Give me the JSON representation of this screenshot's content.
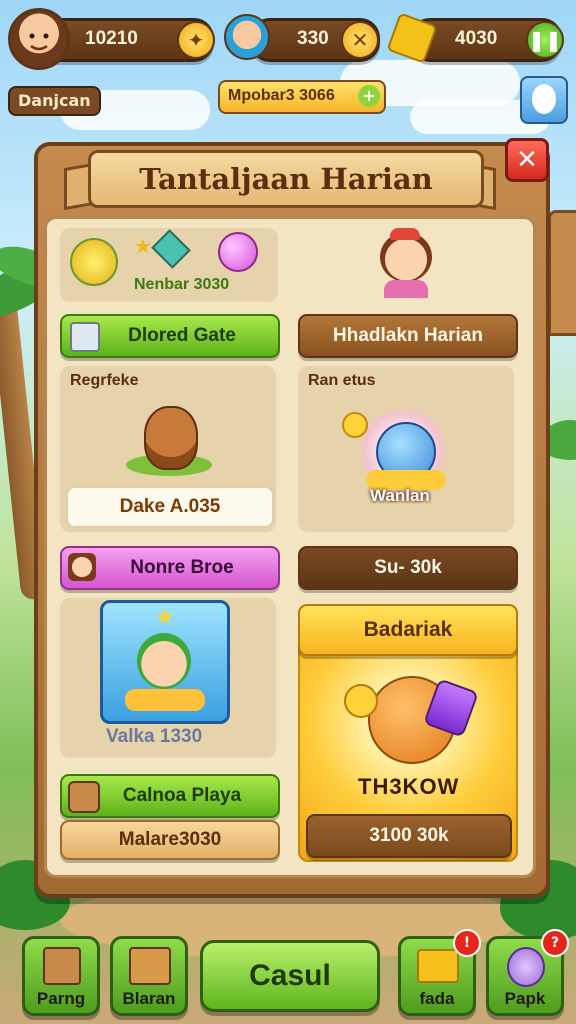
{
  "hud": {
    "coins": "10210",
    "gems": "330",
    "energy": "4030",
    "player_name": "Danjcan",
    "reward_banner": "Mpobar3 3066"
  },
  "panel": {
    "title": "Tantaljaan Harian",
    "close": "✕"
  },
  "cards": {
    "top_left_value": "Nenbar 3030",
    "green_button_1": "Dlored Gate",
    "daily_button": "Hhadlakn Harian",
    "card2_title": "Regrfeke",
    "card2_value": "Dake A.035",
    "card3_title": "Ran etus",
    "card3_value": "Wanlan",
    "pink_button": "Nonre Broe",
    "right_button": "Su- 30k",
    "avatar_card_value": "Valka 1330",
    "green_button_2": "Calnoa Playa",
    "tan_button": "Malare3030",
    "featured_title": "Badariak",
    "featured_name": "TH3KOW",
    "featured_price": "3100 30k"
  },
  "bottom_nav": [
    {
      "label": "Parng"
    },
    {
      "label": "Blaran"
    },
    {
      "label": "Casul"
    },
    {
      "label": "fada",
      "badge": "!"
    },
    {
      "label": "Papk",
      "badge": "?"
    }
  ]
}
